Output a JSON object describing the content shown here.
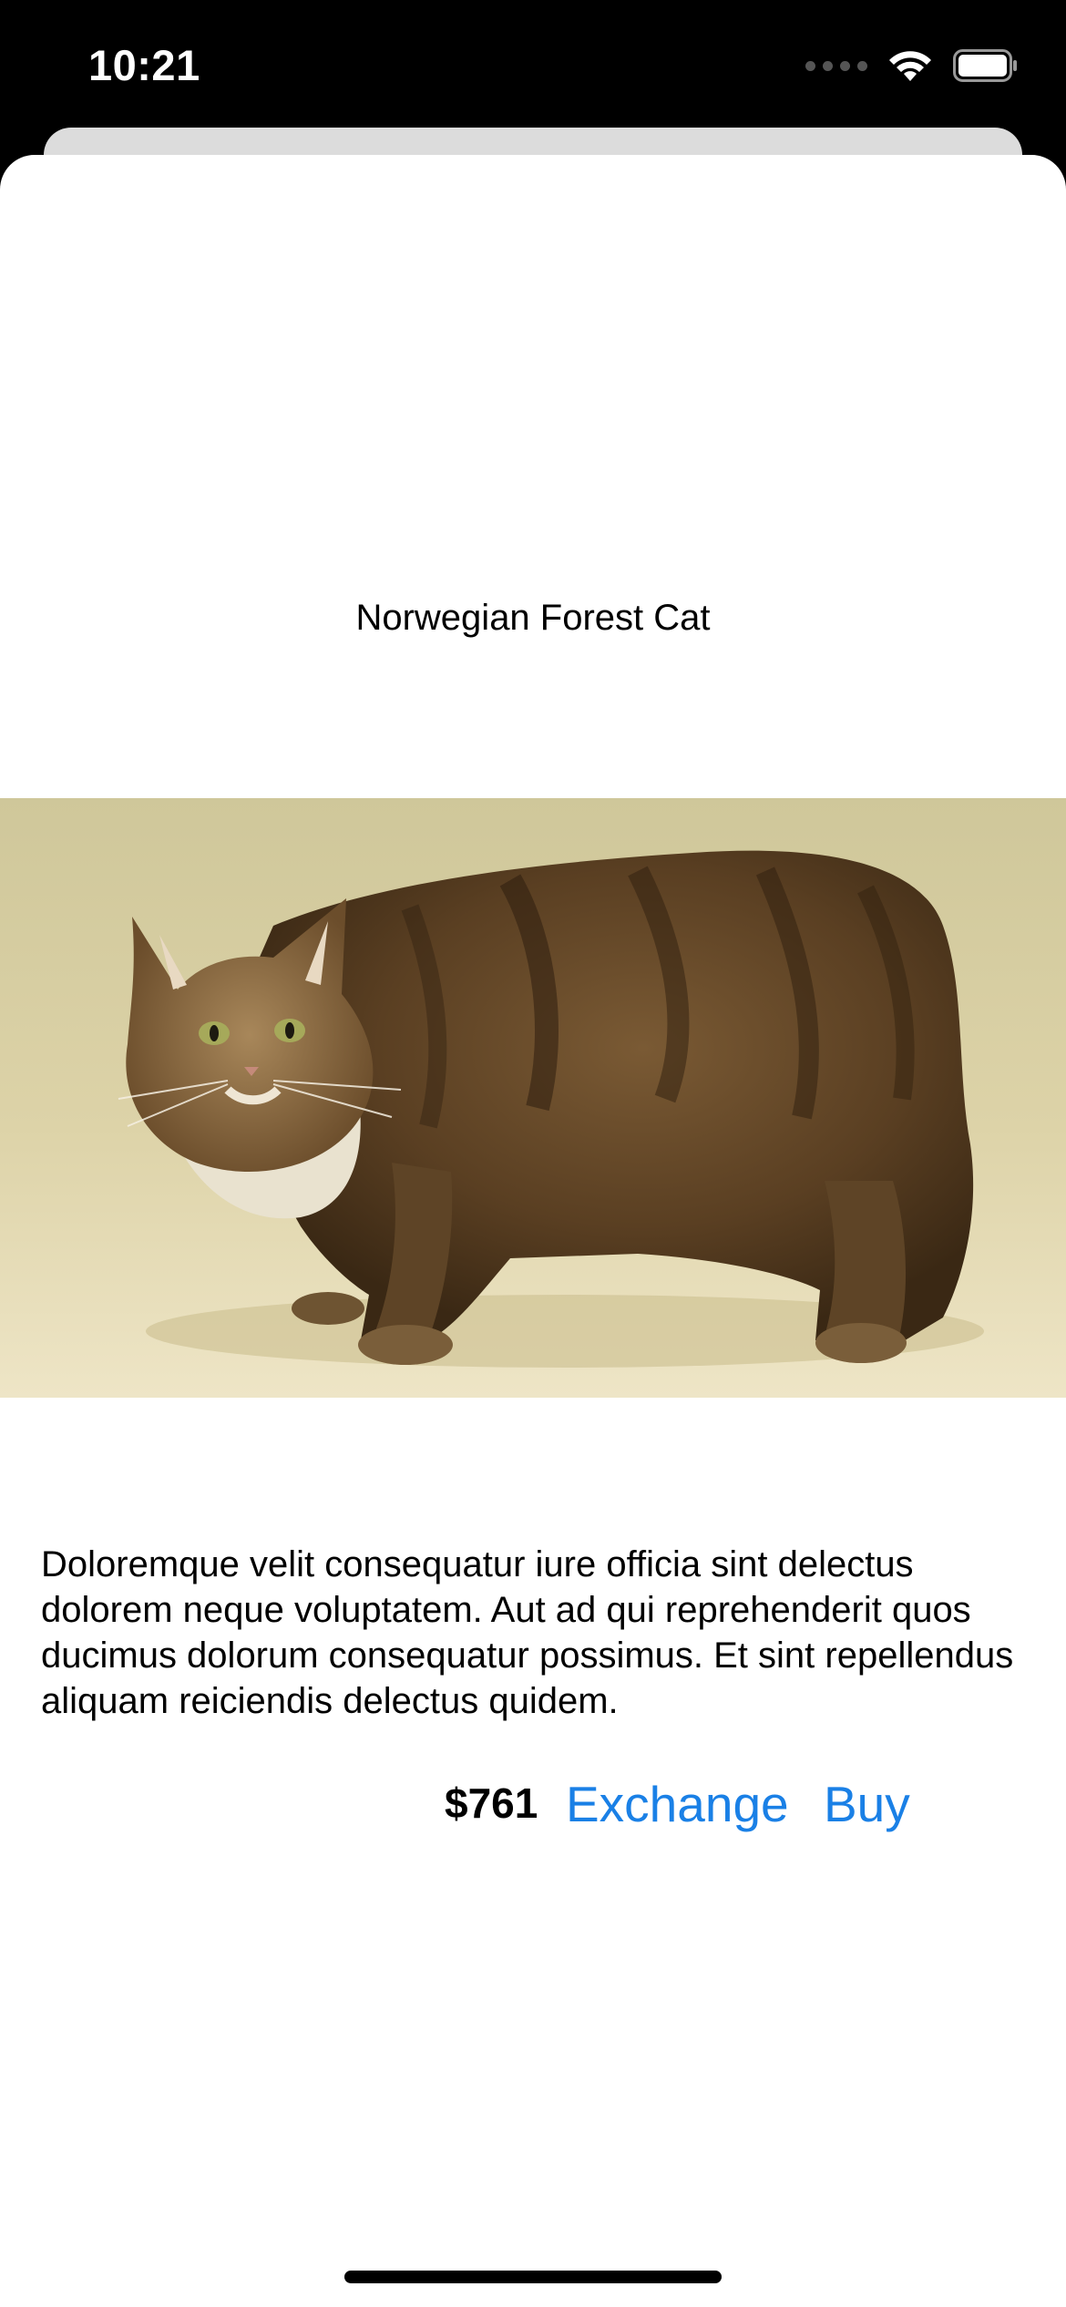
{
  "status_bar": {
    "time": "10:21"
  },
  "product": {
    "title": "Norwegian Forest Cat",
    "image_alt": "Norwegian Forest Cat photo",
    "description": "Doloremque velit consequatur iure officia sint delectus dolorem neque voluptatem. Aut ad qui reprehenderit quos ducimus dolorum consequatur possimus. Et sint repellendus aliquam reiciendis delectus quidem.",
    "price": "$761"
  },
  "actions": {
    "exchange_label": "Exchange",
    "buy_label": "Buy"
  },
  "colors": {
    "accent": "#1a80e6",
    "sheet_background": "#ffffff",
    "status_bar_background": "#000000"
  },
  "icons": [
    "signal-dots-icon",
    "wifi-icon",
    "battery-icon"
  ]
}
